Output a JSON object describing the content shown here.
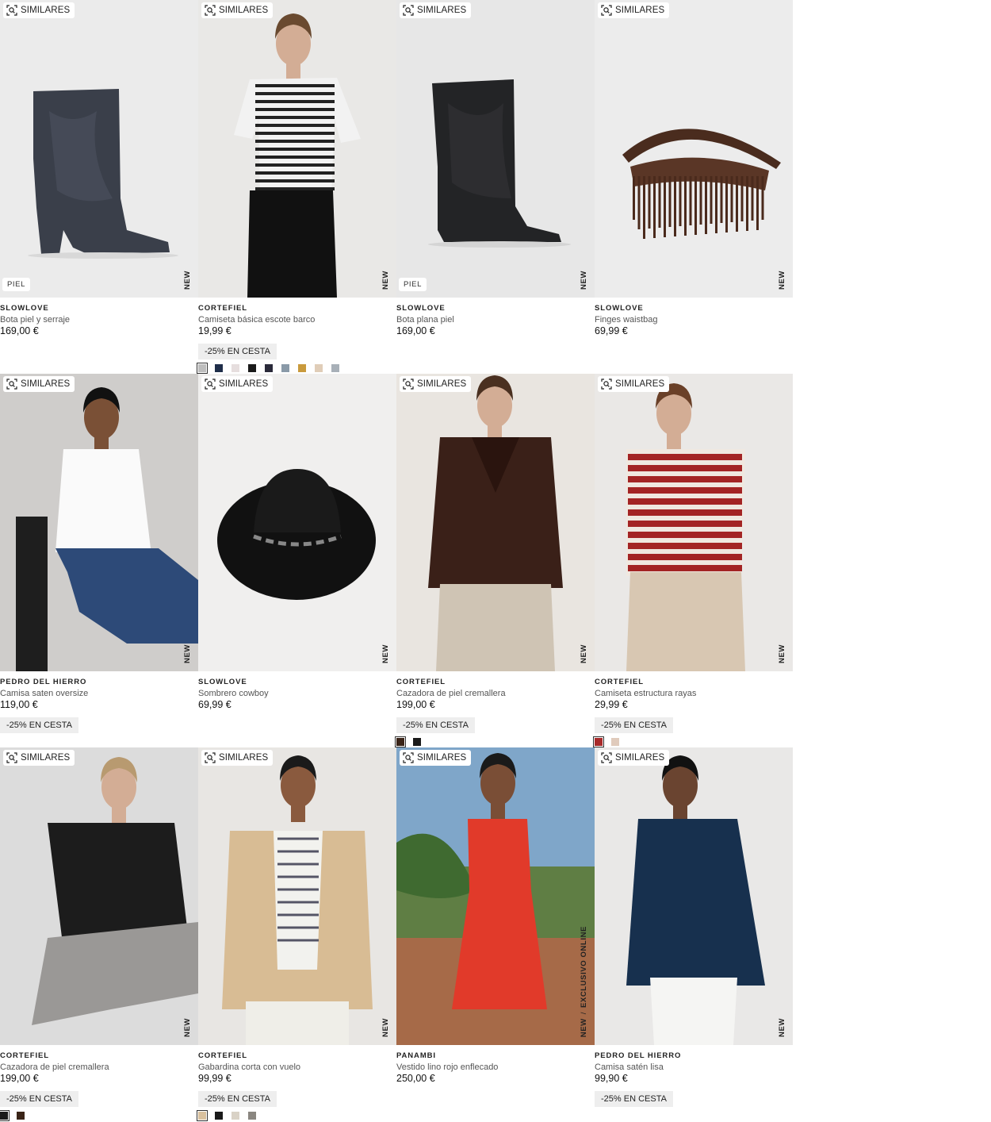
{
  "similar_label": "SIMILARES",
  "products": [
    {
      "brand": "SLOWLOVE",
      "name": "Bota piel y serraje",
      "price": "169,00 €",
      "badge": "PIEL",
      "tag": "NEW",
      "tag2": "",
      "promo": "",
      "scene": "boot-grey",
      "swatches": []
    },
    {
      "brand": "CORTEFIEL",
      "name": "Camiseta básica escote barco",
      "price": "19,99 €",
      "badge": "",
      "tag": "NEW",
      "tag2": "",
      "promo": "-25% EN CESTA",
      "scene": "model-stripes",
      "swatches": [
        "#bdbdbd",
        "#1f2e4a",
        "#e6dede",
        "#1a1a1a",
        "#2a2a3a",
        "#8a9aa8",
        "#c99a3c",
        "#e0cdb8",
        "#a8b0b8"
      ]
    },
    {
      "brand": "SLOWLOVE",
      "name": "Bota plana piel",
      "price": "169,00 €",
      "badge": "PIEL",
      "tag": "NEW",
      "tag2": "",
      "promo": "",
      "scene": "boot-black",
      "swatches": []
    },
    {
      "brand": "SLOWLOVE",
      "name": "Finges waistbag",
      "price": "69,99 €",
      "badge": "",
      "tag": "NEW",
      "tag2": "",
      "promo": "",
      "scene": "bag",
      "swatches": []
    },
    {
      "brand": "PEDRO DEL HIERRO",
      "name": "Camisa saten oversize",
      "price": "119,00 €",
      "badge": "",
      "tag": "NEW",
      "tag2": "",
      "promo": "-25% EN CESTA",
      "scene": "model-white-shirt",
      "swatches": []
    },
    {
      "brand": "SLOWLOVE",
      "name": "Sombrero cowboy",
      "price": "69,99 €",
      "badge": "",
      "tag": "NEW",
      "tag2": "",
      "promo": "",
      "scene": "hat",
      "swatches": []
    },
    {
      "brand": "CORTEFIEL",
      "name": "Cazadora de piel cremallera",
      "price": "199,00 €",
      "badge": "",
      "tag": "NEW",
      "tag2": "",
      "promo": "-25% EN CESTA",
      "scene": "model-leather-brown",
      "swatches": [
        "#3a2418",
        "#1a1a1a"
      ]
    },
    {
      "brand": "CORTEFIEL",
      "name": "Camiseta estructura rayas",
      "price": "29,99 €",
      "badge": "",
      "tag": "NEW",
      "tag2": "",
      "promo": "-25% EN CESTA",
      "scene": "model-red-stripes",
      "swatches": [
        "#a82a2a",
        "#e0cbbc"
      ]
    },
    {
      "brand": "CORTEFIEL",
      "name": "Cazadora de piel cremallera",
      "price": "199,00 €",
      "badge": "",
      "tag": "NEW",
      "tag2": "",
      "promo": "-25% EN CESTA",
      "scene": "model-leather-black",
      "swatches": [
        "#1a1a1a",
        "#3a2418"
      ]
    },
    {
      "brand": "CORTEFIEL",
      "name": "Gabardina corta con vuelo",
      "price": "99,99 €",
      "badge": "",
      "tag": "NEW",
      "tag2": "",
      "promo": "-25% EN CESTA",
      "scene": "model-trench",
      "swatches": [
        "#d9c19e",
        "#1a1a1a",
        "#d9d2c6",
        "#8a8680"
      ]
    },
    {
      "brand": "PANAMBI",
      "name": "Vestido lino rojo enflecado",
      "price": "250,00 €",
      "badge": "",
      "tag": "NEW",
      "tag2": "EXCLUSIVO ONLINE",
      "promo": "",
      "scene": "model-red-dress",
      "swatches": []
    },
    {
      "brand": "PEDRO DEL HIERRO",
      "name": "Camisa satén lisa",
      "price": "99,90 €",
      "badge": "",
      "tag": "NEW",
      "tag2": "",
      "promo": "-25% EN CESTA",
      "scene": "model-navy-shirt",
      "swatches": []
    }
  ]
}
